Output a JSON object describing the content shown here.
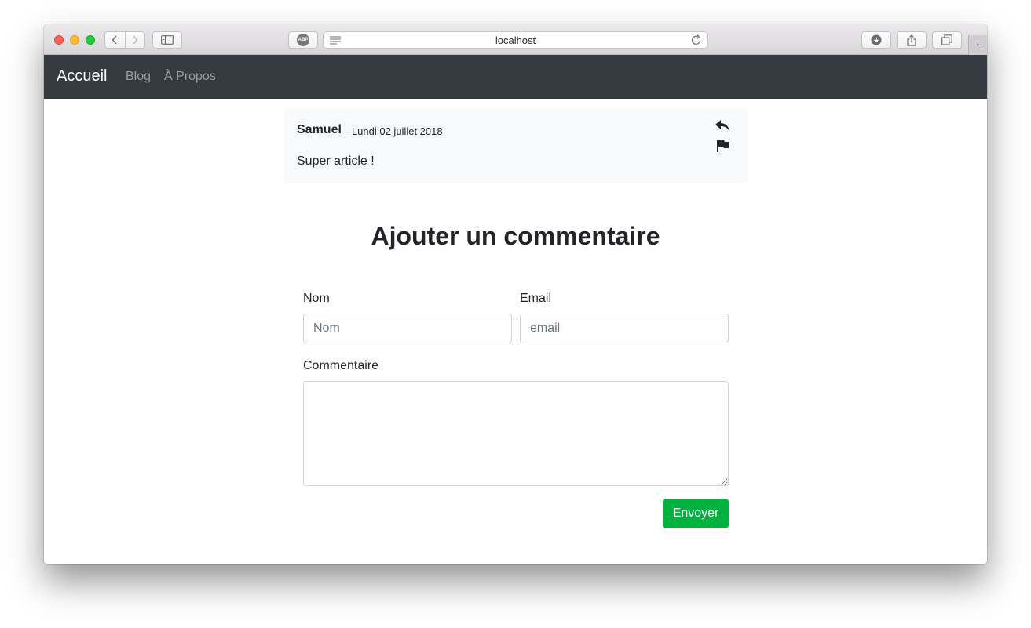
{
  "browser": {
    "url": "localhost",
    "abp_label": "ABP",
    "new_tab_label": "+"
  },
  "navbar": {
    "brand": "Accueil",
    "links": [
      "Blog",
      "À Propos"
    ]
  },
  "comment": {
    "author": "Samuel",
    "date": "- Lundi 02 juillet 2018",
    "text": "Super article !",
    "icons": [
      "reply-icon",
      "flag-icon"
    ]
  },
  "form": {
    "title": "Ajouter un commentaire",
    "name_label": "Nom",
    "name_placeholder": "Nom",
    "email_label": "Email",
    "email_placeholder": "email",
    "comment_label": "Commentaire",
    "submit_label": "Envoyer"
  },
  "colors": {
    "navbar_bg": "#343a40",
    "submit_bg": "#00b140",
    "card_bg": "#f8f9fa"
  }
}
